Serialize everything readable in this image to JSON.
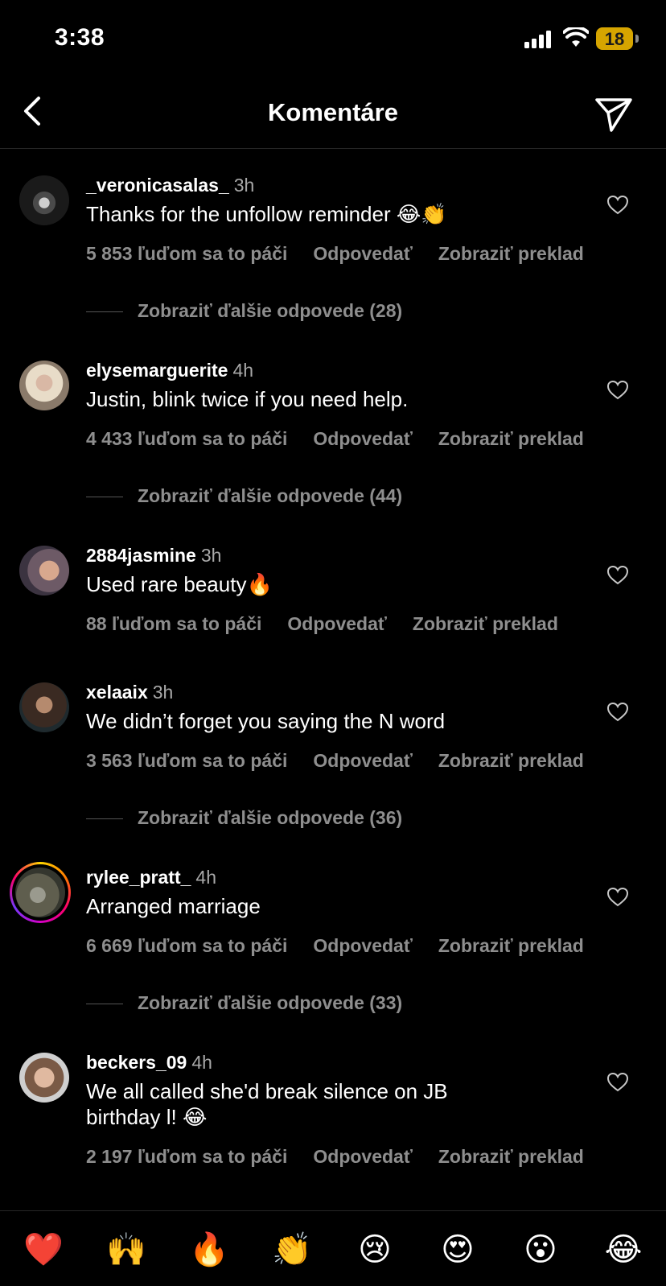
{
  "status": {
    "time": "3:38",
    "battery": "18"
  },
  "header": {
    "title": "Komentáre"
  },
  "comments": [
    {
      "username": "_veronicasalas_",
      "time": "3h",
      "text": "Thanks for the unfollow reminder 😂👏",
      "likes": "5 853 ľuďom sa to páči",
      "reply": "Odpovedať",
      "translate": "Zobraziť preklad",
      "more_replies": "Zobraziť ďalšie odpovede (28)"
    },
    {
      "username": "elysemarguerite",
      "time": "4h",
      "text": "Justin, blink twice if you need help.",
      "likes": "4 433 ľuďom sa to páči",
      "reply": "Odpovedať",
      "translate": "Zobraziť preklad",
      "more_replies": "Zobraziť ďalšie odpovede (44)"
    },
    {
      "username": "2884jasmine",
      "time": "3h",
      "text": "Used rare beauty🔥",
      "likes": "88 ľuďom sa to páči",
      "reply": "Odpovedať",
      "translate": "Zobraziť preklad"
    },
    {
      "username": "xelaaix",
      "time": "3h",
      "text": "We didn’t forget you saying the N word",
      "likes": "3 563 ľuďom sa to páči",
      "reply": "Odpovedať",
      "translate": "Zobraziť preklad",
      "more_replies": "Zobraziť ďalšie odpovede (36)"
    },
    {
      "username": "rylee_pratt_",
      "time": "4h",
      "text": "Arranged marriage",
      "likes": "6 669 ľuďom sa to páči",
      "reply": "Odpovedať",
      "translate": "Zobraziť preklad",
      "more_replies": "Zobraziť ďalšie odpovede (33)"
    },
    {
      "username": "beckers_09",
      "time": "4h",
      "text": "We all called she'd break silence on JB birthday l! 😂",
      "likes": "2 197 ľuďom sa to páči",
      "reply": "Odpovedať",
      "translate": "Zobraziť preklad"
    }
  ],
  "quick_reactions": [
    "❤️",
    "🙌",
    "🔥",
    "👏",
    "😢",
    "😍",
    "😮",
    "😂"
  ],
  "colors": {
    "background": "#000000",
    "secondary_text": "#8e8e8e",
    "battery": "#d6a500"
  }
}
